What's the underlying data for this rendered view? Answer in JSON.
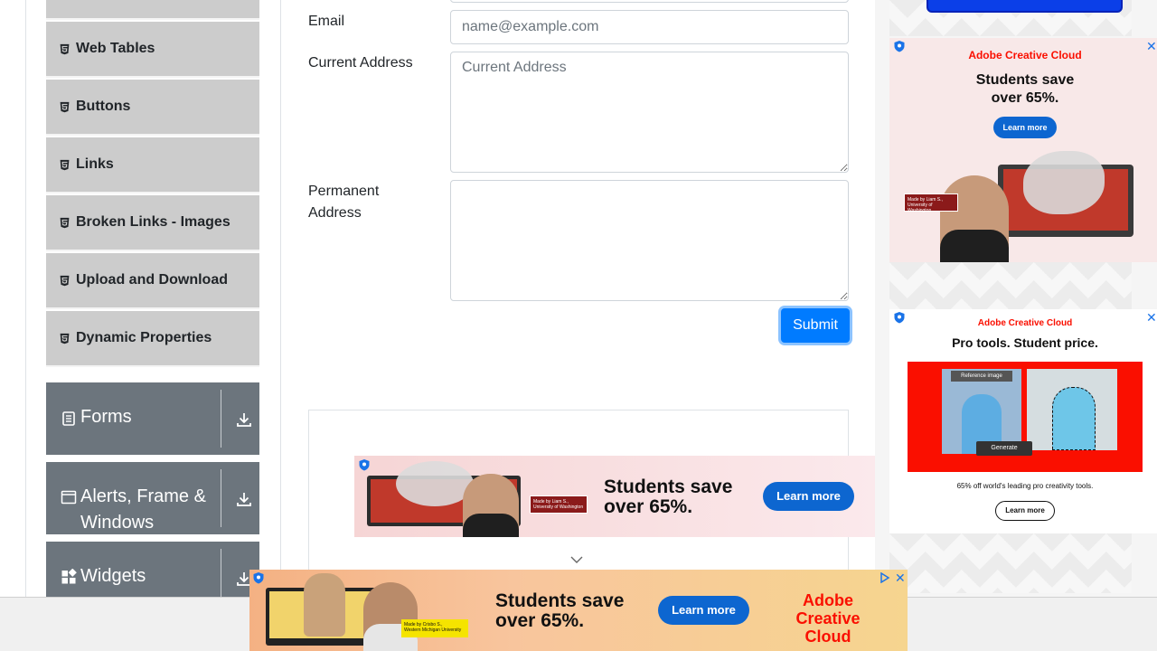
{
  "sidebar": {
    "elements_items": [
      {
        "label": ""
      },
      {
        "label": "Web Tables"
      },
      {
        "label": "Buttons"
      },
      {
        "label": "Links"
      },
      {
        "label": "Broken Links - Images"
      },
      {
        "label": "Upload and Download"
      },
      {
        "label": "Dynamic Properties"
      }
    ],
    "groups": [
      {
        "label": "Forms",
        "icon": "form-icon"
      },
      {
        "label": "Alerts, Frame &",
        "label_line2": "Windows",
        "icon": "window-icon"
      },
      {
        "label": "Widgets",
        "icon": "widgets-icon"
      }
    ]
  },
  "form": {
    "email_label": "Email",
    "email_placeholder": "name@example.com",
    "current_address_label": "Current Address",
    "current_address_placeholder": "Current Address",
    "permanent_address_label_line1": "Permanent",
    "permanent_address_label_line2": "Address",
    "submit_label": "Submit"
  },
  "ads": {
    "right_top": {
      "brand": "Adobe Creative Cloud",
      "headline_line1": "Students save",
      "headline_line2": "over 65%.",
      "cta": "Learn more",
      "caption_line1": "Made by Liam S.,",
      "caption_line2": "University of Washington"
    },
    "right_bottom": {
      "brand": "Adobe Creative Cloud",
      "headline": "Pro tools. Student price.",
      "image_tag": "Reference image",
      "generate": "Generate",
      "subtext": "65% off world's leading pro creativity tools.",
      "cta": "Learn more"
    },
    "middle": {
      "headline_line1": "Students save",
      "headline_line2": "over 65%.",
      "cta": "Learn more",
      "caption_line1": "Made by Liam S.,",
      "caption_line2": "University of Washington"
    },
    "bottom": {
      "headline_line1": "Students save",
      "headline_line2": "over 65%.",
      "cta": "Learn more",
      "brand_line1": "Adobe",
      "brand_line2": "Creative Cloud",
      "caption_line1": "Made by Crisbo S.,",
      "caption_line2": "Western Michigan University"
    }
  },
  "colors": {
    "primary": "#007bff",
    "sidebar_item_bg": "#cccccc",
    "sidebar_group_bg": "#6c757d",
    "adobe_red": "#fa0f00",
    "ad_button_blue": "#0d66d0"
  }
}
